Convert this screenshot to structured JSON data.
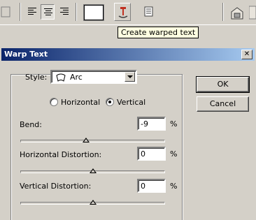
{
  "toolbar": {
    "align_buttons": [
      "align-left",
      "align-center",
      "align-right"
    ],
    "text_color": "#ffffff"
  },
  "tooltip": {
    "text": "Create warped text"
  },
  "dialog": {
    "title": "Warp Text",
    "close_glyph": "✕",
    "style_label": "Style:",
    "style_value": "Arc",
    "orientation": {
      "horizontal_label": "Horizontal",
      "vertical_label": "Vertical",
      "selected": "Vertical"
    },
    "bend": {
      "label": "Bend:",
      "value": "-9",
      "unit": "%",
      "slider_fraction": 0.455
    },
    "horizontal_distortion": {
      "label": "Horizontal Distortion:",
      "value": "0",
      "unit": "%",
      "slider_fraction": 0.5
    },
    "vertical_distortion": {
      "label": "Vertical Distortion:",
      "value": "0",
      "unit": "%",
      "slider_fraction": 0.5
    },
    "ok_label": "OK",
    "cancel_label": "Cancel"
  }
}
